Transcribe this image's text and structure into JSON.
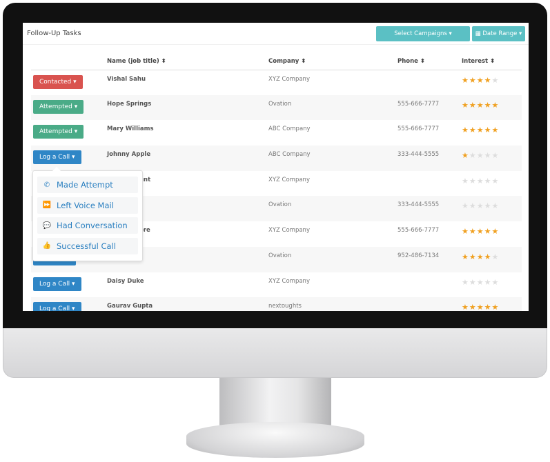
{
  "header": {
    "title": "Follow-Up Tasks",
    "select_campaigns": "Select Campaigns ▾",
    "date_range": "Date Range ▾"
  },
  "columns": [
    "",
    "Name (job title) ⬍",
    "Company ⬍",
    "Phone ⬍",
    "Interest ⬍"
  ],
  "rows": [
    {
      "status": "Contacted ▾",
      "status_color": "#d9534f",
      "name": "Vishal Sahu",
      "company": "XYZ Company",
      "phone": "",
      "interest": 4
    },
    {
      "status": "Attempted ▾",
      "status_color": "#4aab87",
      "name": "Hope Springs",
      "company": "Ovation",
      "phone": "555-666-7777",
      "interest": 5
    },
    {
      "status": "Attempted ▾",
      "status_color": "#4aab87",
      "name": "Mary Williams",
      "company": "ABC Company",
      "phone": "555-666-7777",
      "interest": 5
    },
    {
      "status": "Log a Call ▾",
      "status_color": "#2f86c6",
      "name": "Johnny Apple",
      "company": "ABC Company",
      "phone": "333-444-5555",
      "interest": 1
    },
    {
      "status": "",
      "name": "unt",
      "company": "XYZ Company",
      "phone": "",
      "interest": 0
    },
    {
      "status": "",
      "name": "",
      "company": "Ovation",
      "phone": "333-444-5555",
      "interest": 0
    },
    {
      "status": "",
      "name": "ore",
      "company": "XYZ Company",
      "phone": "555-666-7777",
      "interest": 5
    },
    {
      "status": "Log a Call",
      "status_color": "#2f86c6",
      "name": "",
      "company": "Ovation",
      "phone": "952-486-7134",
      "interest": 4
    },
    {
      "status": "Log a Call ▾",
      "status_color": "#2f86c6",
      "name": "Daisy Duke",
      "company": "XYZ Company",
      "phone": "",
      "interest": 0
    },
    {
      "status": "Log a Call ▾",
      "status_color": "#2f86c6",
      "name": "Gaurav Gupta",
      "company": "nextoughts",
      "phone": "",
      "interest": 5
    }
  ],
  "dropdown": [
    {
      "label": "Made Attempt",
      "icon": "phone-icon",
      "glyph": "✆"
    },
    {
      "label": "Left Voice Mail",
      "icon": "fast-forward-icon",
      "glyph": "⏩"
    },
    {
      "label": "Had Conversation",
      "icon": "chat-icon",
      "glyph": "💬"
    },
    {
      "label": "Successful Call",
      "icon": "thumbs-up-icon",
      "glyph": "👍"
    }
  ],
  "colors": {
    "accent": "#5bc0c4",
    "link": "#2a7fc0",
    "star": "#f0a020"
  }
}
